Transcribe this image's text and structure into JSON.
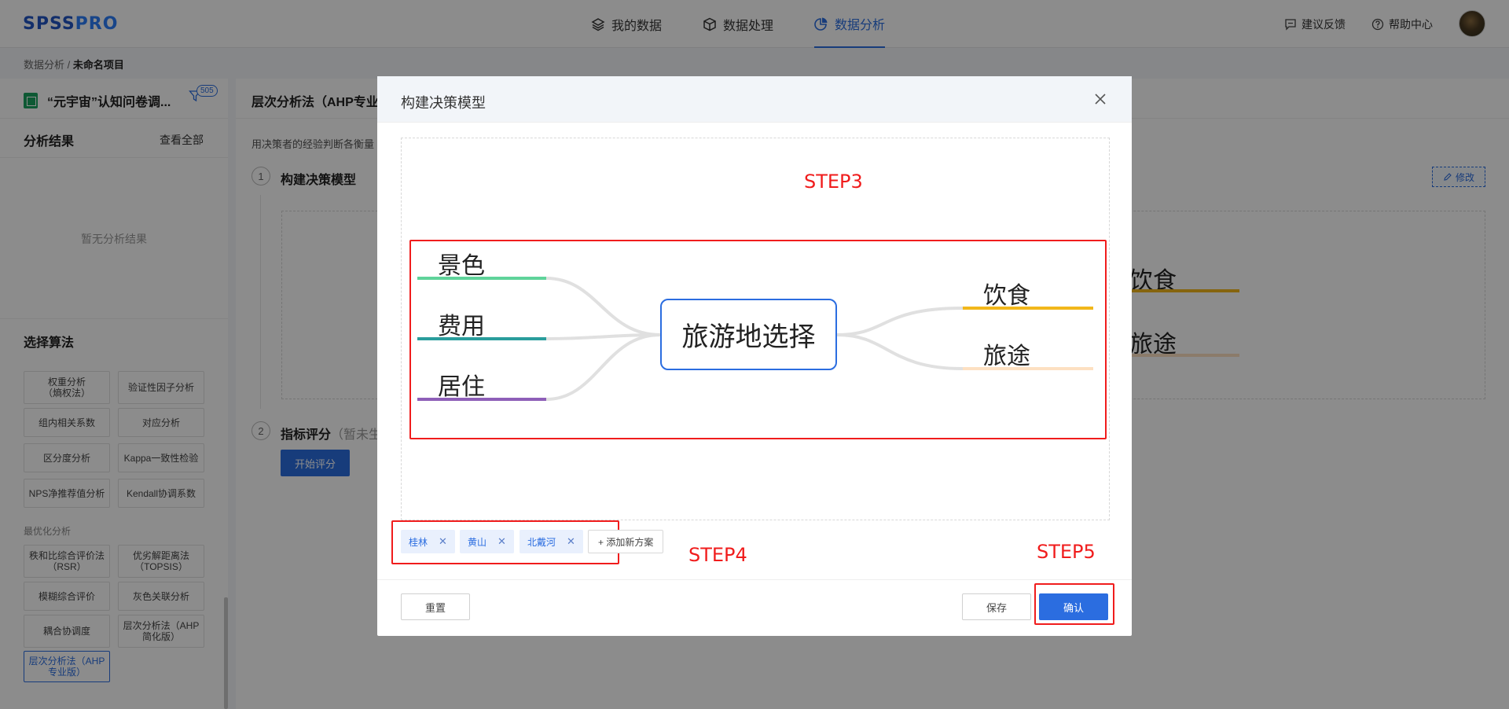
{
  "brand": {
    "logo_main": "SPSS",
    "logo_accent": "PRO"
  },
  "nav": {
    "tabs": [
      {
        "label": "我的数据",
        "icon": "layers-icon"
      },
      {
        "label": "数据处理",
        "icon": "cube-icon"
      },
      {
        "label": "数据分析",
        "icon": "pie-chart-icon",
        "active": true
      }
    ],
    "feedback": "建议反馈",
    "help": "帮助中心"
  },
  "breadcrumb": {
    "parent": "数据分析 / ",
    "current": "未命名项目"
  },
  "sidebar": {
    "dataset_title": "“元宇宙”认知问卷调...",
    "filter_count": "505",
    "results_title": "分析结果",
    "view_all": "查看全部",
    "no_result": "暂无分析结果",
    "algo_title": "选择算法",
    "algos": [
      "权重分析\n（熵权法）",
      "验证性因子分析",
      "组内相关系数",
      "对应分析",
      "区分度分析",
      "Kappa一致性检验",
      "NPS净推荐值分析",
      "Kendall协调系数"
    ],
    "group_opt": "最优化分析",
    "algos_opt": [
      "秩和比综合评价法\n（RSR）",
      "优劣解距离法\n（TOPSIS）",
      "模糊综合评价",
      "灰色关联分析",
      "耦合协调度",
      "层次分析法（AHP\n简化版）",
      "层次分析法（AHP\n专业版）"
    ]
  },
  "main": {
    "title": "层次分析法（AHP专业",
    "desc": "用决策者的经验判断各衡量",
    "step1_num": "1",
    "step1_title": "构建决策模型",
    "edit": "修改",
    "step2_num": "2",
    "step2_title": "指标评分",
    "step2_note": "（暂未生",
    "start": "开始评分",
    "bg_nodes": [
      "饮食",
      "旅途"
    ]
  },
  "modal": {
    "title": "构建决策模型",
    "step3": "STEP3",
    "step4": "STEP4",
    "step5": "STEP5",
    "center": "旅游地选择",
    "left_nodes": [
      {
        "label": "景色",
        "color": "#5fd39a"
      },
      {
        "label": "费用",
        "color": "#2a9d9c"
      },
      {
        "label": "居住",
        "color": "#8e5fb8"
      }
    ],
    "right_nodes": [
      {
        "label": "饮食",
        "color": "#f2b71a"
      },
      {
        "label": "旅途",
        "color": "#fde0c2"
      }
    ],
    "options": [
      "桂林",
      "黄山",
      "北戴河"
    ],
    "add_option": "+ 添加新方案",
    "reset": "重置",
    "save": "保存",
    "confirm": "确认"
  }
}
